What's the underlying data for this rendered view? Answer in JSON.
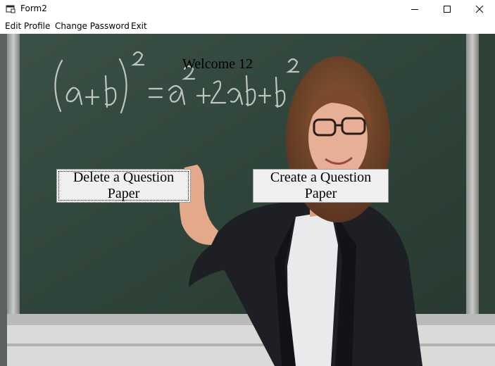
{
  "window": {
    "title": "Form2",
    "controls": [
      "minimize-icon",
      "maximize-icon",
      "close-icon"
    ]
  },
  "menu": {
    "items": [
      {
        "label": "Edit Profile"
      },
      {
        "label": "Change Password"
      },
      {
        "label": "Exit"
      }
    ]
  },
  "main": {
    "welcome_text": "Welcome 12",
    "delete_button_label": "Delete a Question Paper",
    "create_button_label": "Create a Question Paper",
    "background_image": "teacher-at-chalkboard-photo",
    "chalk_formula": "(a+b)² = a² + 2ab + b²"
  },
  "colors": {
    "chalkboard": "#33473d",
    "button_face": "#f0f0f0",
    "window_bg": "#ffffff"
  }
}
